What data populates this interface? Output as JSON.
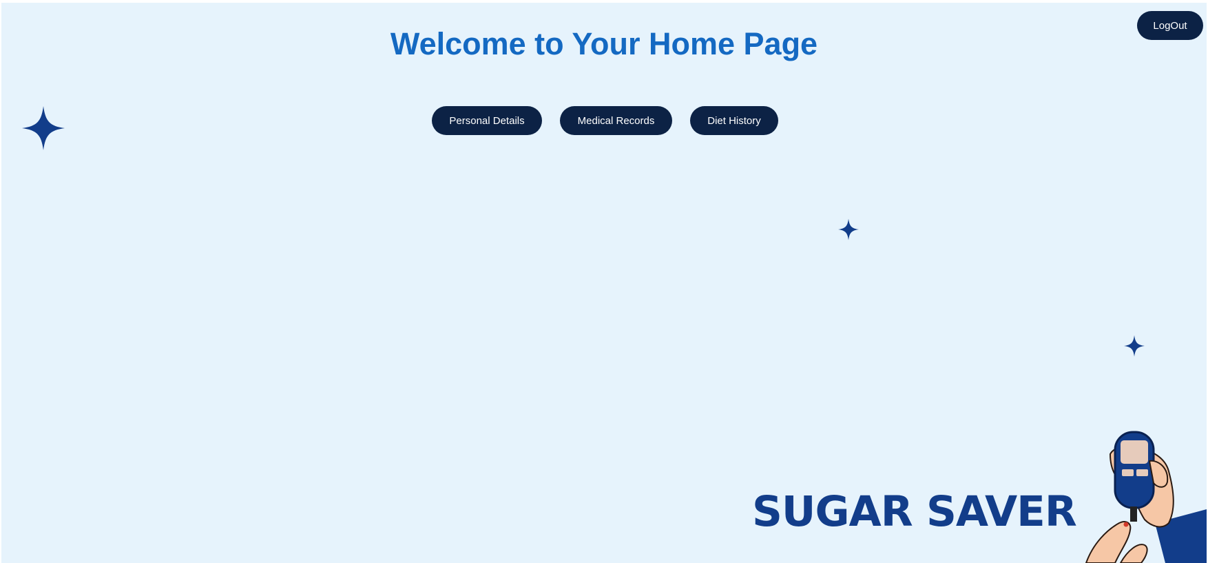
{
  "page": {
    "title": "Welcome to Your Home Page"
  },
  "header": {
    "logout_label": "LogOut"
  },
  "nav": {
    "buttons": [
      {
        "label": "Personal Details"
      },
      {
        "label": "Medical Records"
      },
      {
        "label": "Diet History"
      }
    ]
  },
  "brand": {
    "name": "SUGAR SAVER",
    "illustration_icon": "glucometer-hand-icon"
  },
  "decorations": {
    "sparkle_icon": "four-point-star-icon"
  },
  "colors": {
    "background": "#e6f3fc",
    "title": "#1469c2",
    "button_bg": "#0c2245",
    "button_text": "#ffffff",
    "brand": "#123d8a",
    "sparkle": "#123d8a"
  }
}
